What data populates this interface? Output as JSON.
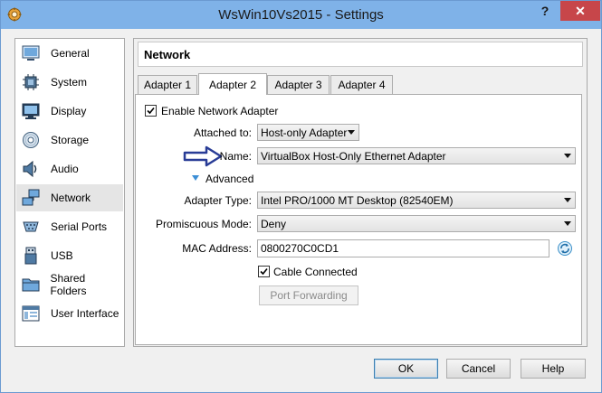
{
  "window": {
    "title": "WsWin10Vs2015 - Settings",
    "help_glyph": "?",
    "close_glyph": "✕"
  },
  "sidebar": {
    "items": [
      {
        "label": "General",
        "icon": "general-icon"
      },
      {
        "label": "System",
        "icon": "chip-icon"
      },
      {
        "label": "Display",
        "icon": "monitor-icon"
      },
      {
        "label": "Storage",
        "icon": "disk-icon"
      },
      {
        "label": "Audio",
        "icon": "speaker-icon"
      },
      {
        "label": "Network",
        "icon": "network-icon",
        "selected": true
      },
      {
        "label": "Serial Ports",
        "icon": "serial-port-icon"
      },
      {
        "label": "USB",
        "icon": "usb-icon"
      },
      {
        "label": "Shared Folders",
        "icon": "folder-icon"
      },
      {
        "label": "User Interface",
        "icon": "user-interface-icon"
      }
    ]
  },
  "panel": {
    "title": "Network"
  },
  "tabs": [
    {
      "label": "Adapter 1",
      "mnemonic": "1"
    },
    {
      "label": "Adapter 2",
      "mnemonic": "2",
      "active": true
    },
    {
      "label": "Adapter 3",
      "mnemonic": "3"
    },
    {
      "label": "Adapter 4",
      "mnemonic": "4"
    }
  ],
  "adapter": {
    "enable_label": "Enable Network Adapter",
    "enabled": true,
    "attached_to_label": "Attached to:",
    "attached_to_value": "Host-only Adapter",
    "name_label": "Name:",
    "name_value": "VirtualBox Host-Only Ethernet Adapter",
    "advanced_label": "Advanced",
    "adapter_type_label": "Adapter Type:",
    "adapter_type_value": "Intel PRO/1000 MT Desktop (82540EM)",
    "promiscuous_label": "Promiscuous Mode:",
    "promiscuous_value": "Deny",
    "mac_label": "MAC Address:",
    "mac_value": "0800270C0CD1",
    "cable_label": "Cable Connected",
    "cable_connected": true,
    "port_forwarding_label": "Port Forwarding"
  },
  "buttons": {
    "ok": "OK",
    "cancel": "Cancel",
    "help": "Help"
  },
  "colors": {
    "titlebar": "#7fb2e8",
    "close": "#c7464a",
    "arrow": "#283c96",
    "accent": "#3c7fb1"
  }
}
